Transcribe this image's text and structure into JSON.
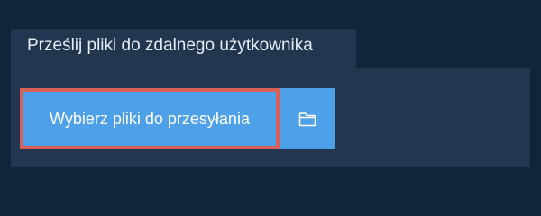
{
  "tab": {
    "label": "Prześlij pliki do zdalnego użytkownika"
  },
  "upload": {
    "choose_label": "Wybierz pliki do przesyłania",
    "folder_icon": "folder-icon"
  },
  "colors": {
    "background": "#12243a",
    "panel": "#22374f",
    "button": "#4ea1e9",
    "highlight_border": "#d86058",
    "text": "#ffffff"
  }
}
